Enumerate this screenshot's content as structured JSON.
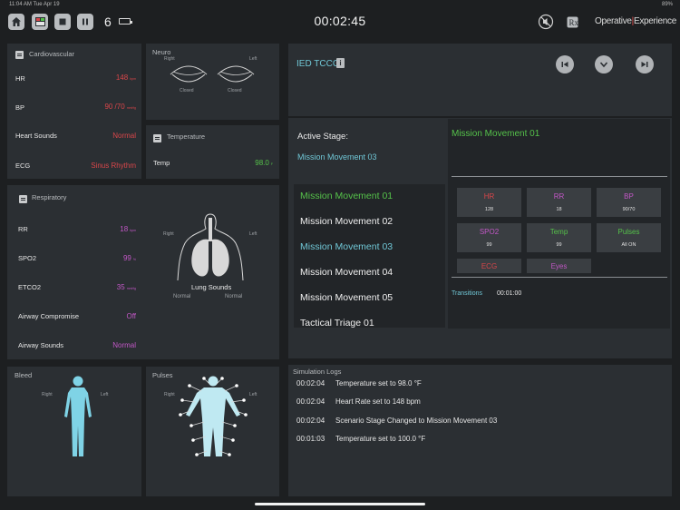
{
  "status_bar": {
    "time": "11:04 AM   Tue Apr 19",
    "battery": "89%"
  },
  "topbar": {
    "scenario_count": "6",
    "elapsed": "00:02:45",
    "brand_left": "Operative",
    "brand_right": "Experience"
  },
  "cardiovascular": {
    "title": "Cardiovascular",
    "hr": {
      "label": "HR",
      "value": "148",
      "unit": "bpm"
    },
    "bp": {
      "label": "BP",
      "value": "90 /70",
      "unit": "mmHg"
    },
    "heart_sounds": {
      "label": "Heart Sounds",
      "value": "Normal"
    },
    "ecg": {
      "label": "ECG",
      "value": "Sinus Rhythm"
    }
  },
  "neuro": {
    "title": "Neuro",
    "right_label": "Right",
    "left_label": "Left",
    "right_eye": "Closed",
    "left_eye": "Closed"
  },
  "temperature": {
    "title": "Temperature",
    "label": "Temp",
    "value": "98.0",
    "unit": "F"
  },
  "respiratory": {
    "title": "Respiratory",
    "rr": {
      "label": "RR",
      "value": "18",
      "unit": "bpm"
    },
    "spo2": {
      "label": "SPO2",
      "value": "99",
      "unit": "%"
    },
    "etco2": {
      "label": "ETCO2",
      "value": "35",
      "unit": "mmHg"
    },
    "airway_compromise": {
      "label": "Airway Compromise",
      "value": "Off"
    },
    "airway_sounds": {
      "label": "Airway Sounds",
      "value": "Normal"
    },
    "lung_right_label": "Right",
    "lung_left_label": "Left",
    "lung_sounds_title": "Lung Sounds",
    "lung_right": "Normal",
    "lung_left": "Normal"
  },
  "bleed": {
    "title": "Bleed",
    "right_label": "Right",
    "left_label": "Left"
  },
  "pulses": {
    "title": "Pulses",
    "right_label": "Right",
    "left_label": "Left"
  },
  "scenario": {
    "name": "IED TCCC",
    "info_icon": "i",
    "active_stage_label": "Active Stage:",
    "active_stage": "Mission Movement 03",
    "stages": [
      "Mission Movement 01",
      "Mission Movement 02",
      "Mission Movement 03",
      "Mission Movement 04",
      "Mission Movement 05",
      "Tactical Triage 01"
    ],
    "selected_stage_title": "Mission Movement 01",
    "params": [
      {
        "label": "HR",
        "value": "128"
      },
      {
        "label": "RR",
        "value": "18"
      },
      {
        "label": "BP",
        "value": "90/70"
      },
      {
        "label": "SPO2",
        "value": "99"
      },
      {
        "label": "Temp",
        "value": "99"
      },
      {
        "label": "Pulses",
        "value": "All ON"
      },
      {
        "label": "ECG",
        "value": ""
      },
      {
        "label": "Eyes",
        "value": ""
      }
    ],
    "transitions_label": "Transitions",
    "transitions_value": "00:01:00"
  },
  "logs": {
    "title": "Simulation Logs",
    "entries": [
      {
        "time": "00:02:04",
        "message": "Temperature set to 98.0 °F"
      },
      {
        "time": "00:02:04",
        "message": "Heart Rate set to 148 bpm"
      },
      {
        "time": "00:02:04",
        "message": "Scenario Stage Changed to Mission Movement 03"
      },
      {
        "time": "00:01:03",
        "message": "Temperature set to 100.0 °F"
      }
    ]
  },
  "colors": {
    "background": "#1d1f21",
    "panel": "#2b2f33",
    "alert_red": "#d9464a",
    "ok_green": "#55c24a",
    "resp_pink": "#c257c6",
    "accent_teal": "#70c7d6",
    "body_blue": "#7fd3e6"
  }
}
